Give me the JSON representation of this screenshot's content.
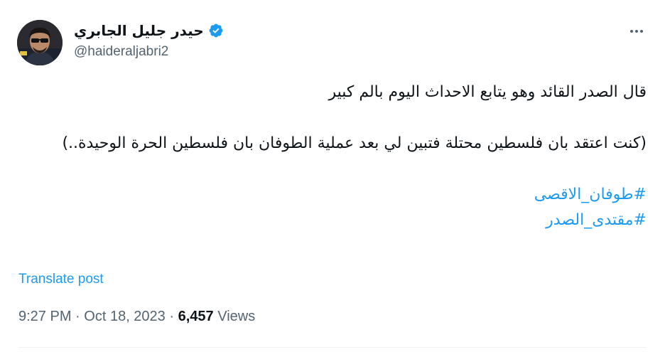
{
  "author": {
    "display_name": "حيدر جليل الجابري",
    "handle": "@haideraljabri2",
    "verified": true,
    "verified_color": "#1d9bf0"
  },
  "post": {
    "lines": [
      "قال الصدر القائد وهو يتابع الاحداث اليوم بالم كبير",
      "",
      "(كنت اعتقد بان فلسطين محتلة فتبين لي بعد عملية الطوفان بان فلسطين الحرة الوحيدة..)",
      ""
    ],
    "hashtags": [
      "#طوفان_الاقصى",
      "#مقتدى_الصدر"
    ]
  },
  "actions": {
    "translate_label": "Translate post",
    "more_icon": "more-dots-icon"
  },
  "meta": {
    "time": "9:27 PM",
    "separator": "·",
    "date": "Oct 18, 2023",
    "views_count": "6,457",
    "views_label": "Views"
  },
  "colors": {
    "link": "#1d9bf0",
    "secondary_text": "#536471",
    "primary_text": "#0f1419"
  }
}
